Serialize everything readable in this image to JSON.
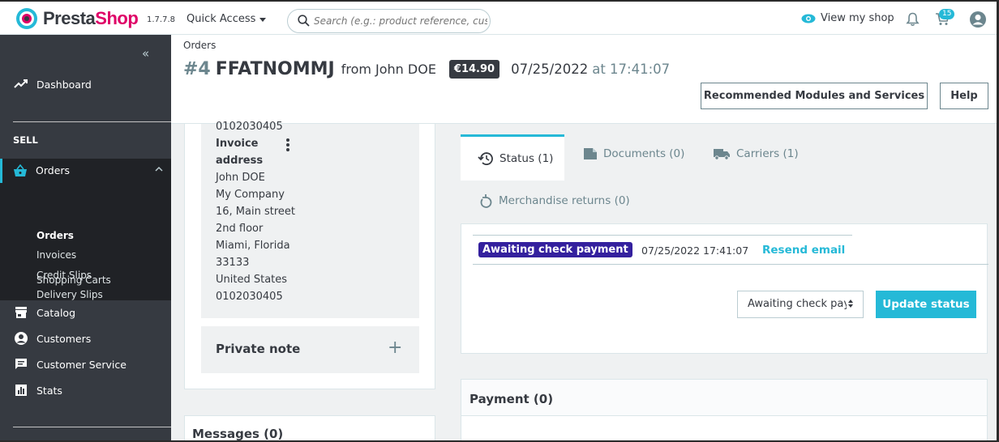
{
  "topbar": {
    "logo_presta": "Presta",
    "logo_shop": "Shop",
    "version": "1.7.7.8",
    "quick_access": "Quick Access",
    "search_placeholder": "Search (e.g.: product reference, custome",
    "view_shop": "View my shop",
    "cart_count": "15"
  },
  "sidebar": {
    "dashboard": "Dashboard",
    "section_sell": "SELL",
    "orders": "Orders",
    "orders_sub": [
      "Orders",
      "Invoices",
      "Credit Slips",
      "Delivery Slips",
      "Shopping Carts"
    ],
    "catalog": "Catalog",
    "customers": "Customers",
    "customer_service": "Customer Service",
    "stats": "Stats"
  },
  "header": {
    "breadcrumb": "Orders",
    "order_num": "#4",
    "order_ref": "FFATNOMMJ",
    "from": "from John DOE",
    "total": "€14.90",
    "date": "07/25/2022",
    "at": "at 17:41:07",
    "recommended_btn": "Recommended Modules and Services",
    "help_btn": "Help"
  },
  "address": {
    "phone_top": "0102030405",
    "invoice_label_1": "Invoice",
    "invoice_label_2": "address",
    "lines": [
      "John DOE",
      "My Company",
      "16, Main street",
      "2nd floor",
      "Miami, Florida",
      "33133",
      "United States",
      "0102030405"
    ]
  },
  "private_note": {
    "title": "Private note",
    "plus": "+"
  },
  "messages": {
    "title": "Messages (0)"
  },
  "tabs": {
    "status": "Status (1)",
    "documents": "Documents (0)",
    "carriers": "Carriers (1)",
    "returns": "Merchandise returns (0)"
  },
  "status_history": {
    "status": "Awaiting check payment",
    "status_color": "#34209e",
    "date": "07/25/2022 17:41:07",
    "resend": "Resend email",
    "select_value": "Awaiting check payment",
    "update_btn": "Update status"
  },
  "payment": {
    "title": "Payment (0)"
  },
  "colors": {
    "accent": "#25b9d7",
    "sidebar_bg": "#363a41",
    "brand_pink": "#df0067"
  }
}
